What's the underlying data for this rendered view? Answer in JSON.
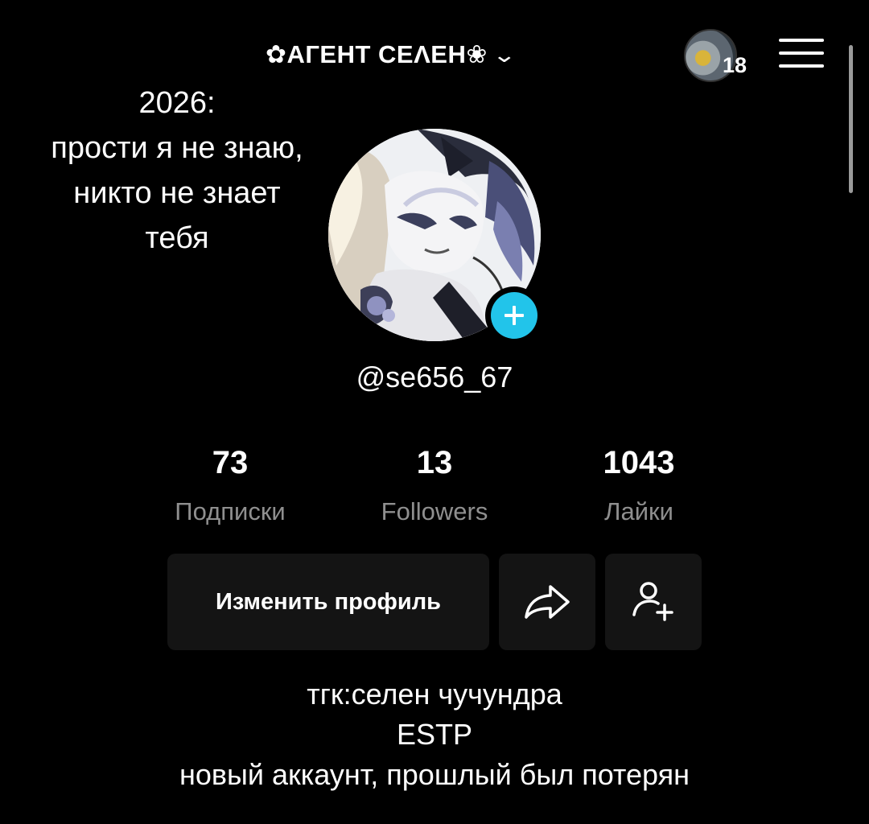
{
  "header": {
    "account_name": "✿АГЕНТ СЕΛЕН❀",
    "story_count": "18"
  },
  "caption": {
    "lines": [
      "2026:",
      "прости я не знаю,",
      "никто не знает",
      "тебя"
    ]
  },
  "profile": {
    "handle": "@se656_67"
  },
  "stats": [
    {
      "value": "73",
      "label": "Подписки"
    },
    {
      "value": "13",
      "label": "Followers"
    },
    {
      "value": "1043",
      "label": "Лайки"
    }
  ],
  "actions": {
    "edit_profile": "Изменить профиль"
  },
  "bio": {
    "lines": [
      "тгк:селен чучундра",
      "ESTP",
      "новый аккаунт, прошлый был потерян"
    ]
  },
  "colors": {
    "background": "#000000",
    "accent_add": "#22c4ea",
    "secondary_text": "#8f8f8f",
    "button_bg": "#141414"
  },
  "icons": [
    "chevron-down-icon",
    "menu-icon",
    "plus-icon",
    "share-icon",
    "add-friend-icon"
  ]
}
